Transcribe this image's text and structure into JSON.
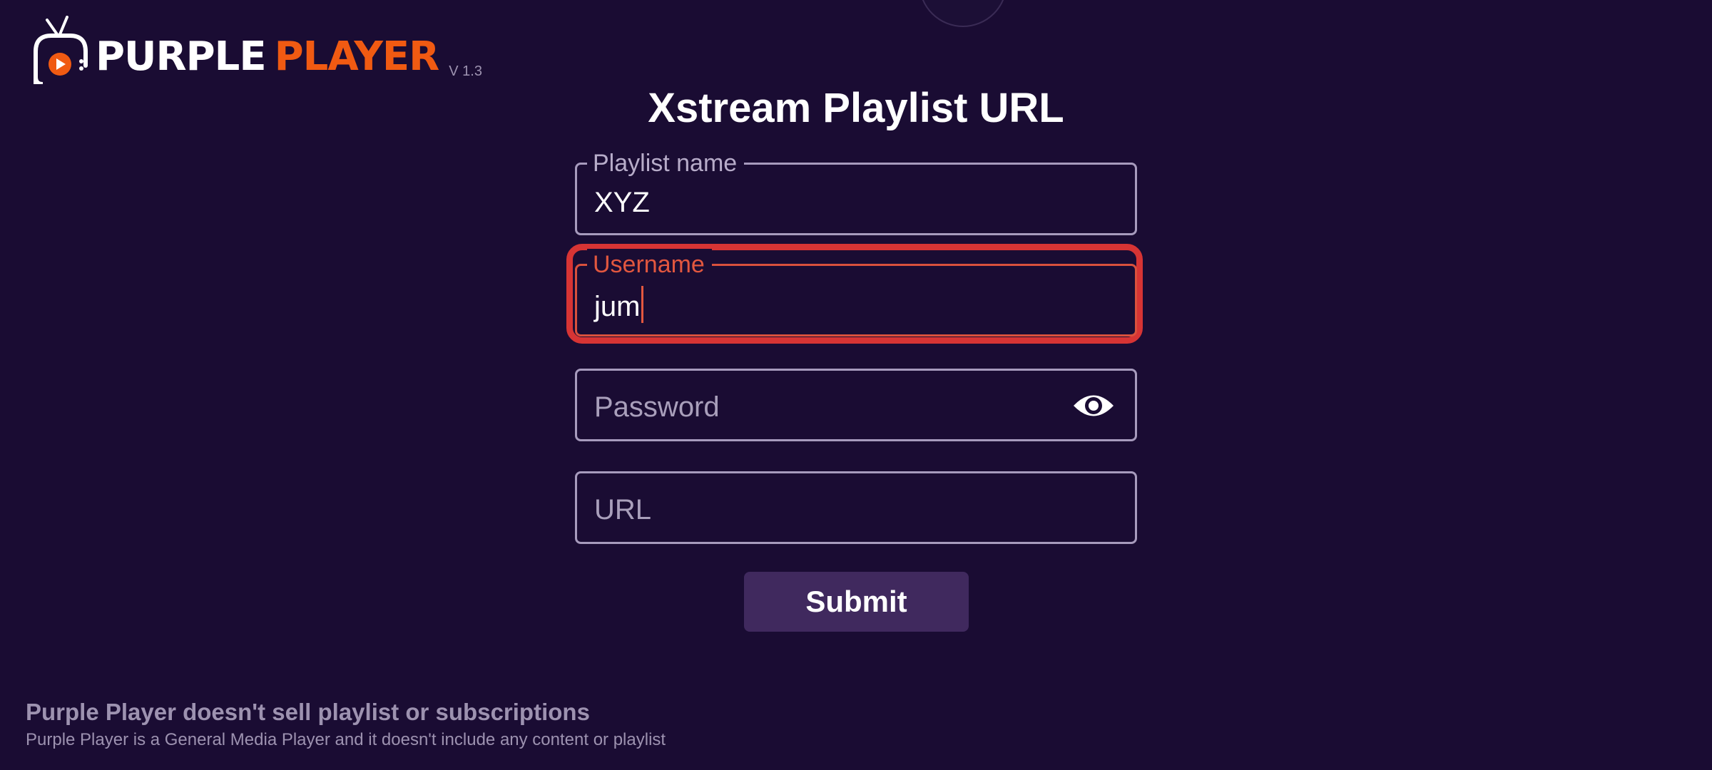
{
  "brand": {
    "word1": "PURPLE",
    "word2": "PLAYER",
    "version": "V 1.3",
    "accent_color": "#f05a12"
  },
  "page": {
    "title": "Xstream Playlist URL",
    "background_color": "#1a0c33"
  },
  "form": {
    "playlist_name": {
      "label": "Playlist name",
      "value": "XYZ"
    },
    "username": {
      "label": "Username",
      "value": "jum",
      "state": "focused",
      "focus_color": "#d73434"
    },
    "password": {
      "placeholder": "Password",
      "value": "",
      "toggle_icon": "eye-icon"
    },
    "url": {
      "placeholder": "URL",
      "value": ""
    },
    "submit_label": "Submit"
  },
  "footer": {
    "disclaimer_title": "Purple Player doesn't sell playlist or subscriptions",
    "disclaimer_body": "Purple Player is a General Media Player and it doesn't include any content or playlist"
  }
}
